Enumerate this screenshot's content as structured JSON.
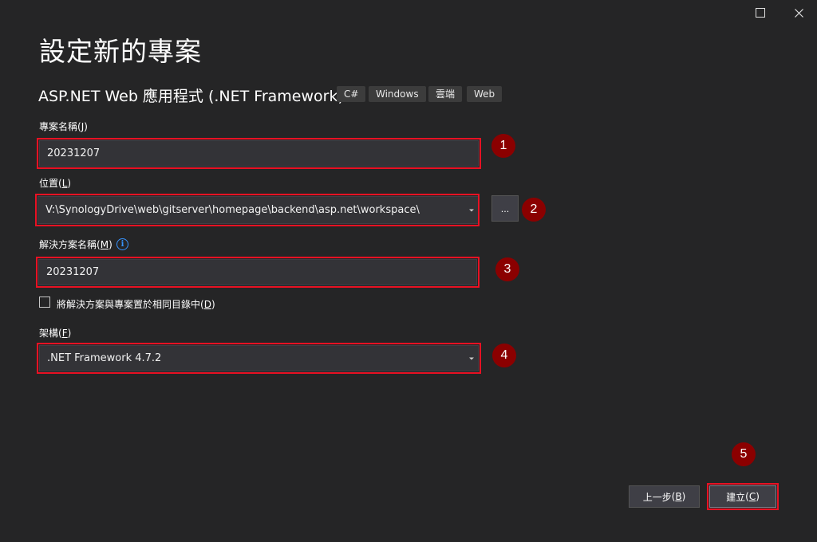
{
  "window": {
    "maximize_icon": "maximize-icon",
    "close_icon": "close-icon"
  },
  "header": {
    "title": "設定新的專案",
    "template_name": "ASP.NET Web 應用程式 (.NET Framework)",
    "tags": [
      "C#",
      "Windows",
      "雲端",
      "Web"
    ]
  },
  "project_name": {
    "label": "專案名稱",
    "accel": "J",
    "value": "20231207"
  },
  "location": {
    "label": "位置",
    "accel": "L",
    "value": "V:\\SynologyDrive\\web\\gitserver\\homepage\\backend\\asp.net\\workspace\\",
    "browse_label": "..."
  },
  "solution_name": {
    "label": "解決方案名稱",
    "accel": "M",
    "info_icon": "info-icon",
    "value": "20231207"
  },
  "same_dir": {
    "label": "將解決方案與專案置於相同目錄中",
    "accel": "D",
    "checked": false
  },
  "framework": {
    "label": "架構",
    "accel": "F",
    "value": ".NET Framework 4.7.2"
  },
  "markers": [
    "1",
    "2",
    "3",
    "4",
    "5"
  ],
  "footer": {
    "back_label": "上一步",
    "back_accel": "B",
    "create_label": "建立",
    "create_accel": "C"
  },
  "colors": {
    "background": "#252526",
    "annotation_red": "#e81123",
    "marker_fill": "#8b0000"
  }
}
